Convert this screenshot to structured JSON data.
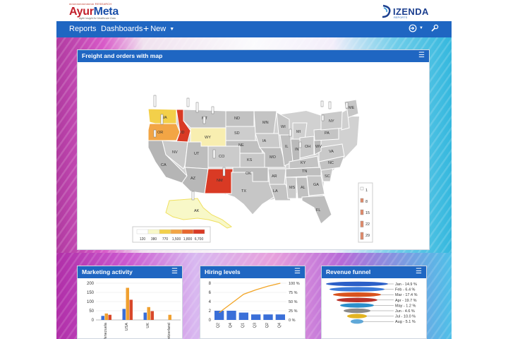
{
  "header": {
    "brand_tagline_top": "mmmmmmmmmm RESEARCH",
    "brand_name_a": "Ayur",
    "brand_name_b": "Meta",
    "brand_subtitle": "Agile Insight for Healthcare Data",
    "partner_name": "IZENDA",
    "partner_sub": "REPORTS"
  },
  "nav": {
    "reports": "Reports",
    "dashboards": "Dashboards",
    "new": "New",
    "icons": [
      "sign-in-icon",
      "wrench-icon"
    ]
  },
  "map_panel": {
    "title": "Freight and orders with map",
    "states": [
      "WA",
      "OR",
      "CA",
      "ID",
      "MT",
      "WY",
      "NV",
      "UT",
      "CO",
      "AZ",
      "NM",
      "ND",
      "SD",
      "NE",
      "KS",
      "OK",
      "TX",
      "MN",
      "IA",
      "MO",
      "AR",
      "LA",
      "WI",
      "IL",
      "MI",
      "IN",
      "OH",
      "KY",
      "TN",
      "MS",
      "AL",
      "GA",
      "FL",
      "SC",
      "NC",
      "VA",
      "WV",
      "PA",
      "NY",
      "ME",
      "AK"
    ],
    "color_legend": [
      "120",
      "380",
      "770",
      "1,500",
      "1,800",
      "6,700"
    ],
    "size_legend": [
      "1",
      "8",
      "15",
      "22",
      "29"
    ],
    "colors": {
      "low": "#f8f8d0",
      "mid": "#f3d04a",
      "high": "#d93a24",
      "neutral": "#b5b5b5"
    }
  },
  "marketing_panel": {
    "title": "Marketing activity",
    "chart_data": {
      "type": "bar",
      "categories": [
        "Venezuela",
        "USA",
        "UK",
        "Switzerland"
      ],
      "series": [
        {
          "values": [
            22,
            60,
            40,
            0
          ]
        },
        {
          "values": [
            35,
            175,
            70,
            28
          ]
        },
        {
          "values": [
            28,
            110,
            48,
            0
          ]
        }
      ],
      "ylim": [
        0,
        200
      ],
      "yticks": [
        "200",
        "150",
        "100",
        "50",
        "0"
      ],
      "colors": [
        "#3a6fd8",
        "#f0a030",
        "#d8482a"
      ]
    }
  },
  "hiring_panel": {
    "title": "Hiring levels",
    "chart_data": {
      "type": "bar",
      "categories": [
        "Q2",
        "Q4",
        "Q1",
        "Q3",
        "Q2",
        "Q4"
      ],
      "bar_values": [
        2,
        2,
        1.6,
        1.2,
        1.2,
        1.2
      ],
      "line_values": [
        20,
        45,
        70,
        82,
        92,
        100
      ],
      "ylim": [
        0,
        8
      ],
      "yticks": [
        "8",
        "6",
        "4",
        "2",
        "0"
      ],
      "y2ticks": [
        "100 %",
        "75 %",
        "50 %",
        "25 %",
        "0 %"
      ],
      "colors": {
        "bar": "#3a6fd8",
        "line": "#f2a526"
      }
    }
  },
  "funnel_panel": {
    "title": "Revenue funnel",
    "labels": [
      "Jan - 14.9 %",
      "Feb - 6.4 %",
      "Mar - 17.4 %",
      "Apr - 19.7 %",
      "May - 1.2 %",
      "Jun - 4.6 %",
      "Jul - 10.0 %",
      "Aug - 5.1 %"
    ],
    "colors": [
      "#2b5fc7",
      "#3c7ad8",
      "#d9531e",
      "#b8322a",
      "#2c8fcb",
      "#8a8a8a",
      "#e3b422",
      "#5fa8d8"
    ]
  }
}
